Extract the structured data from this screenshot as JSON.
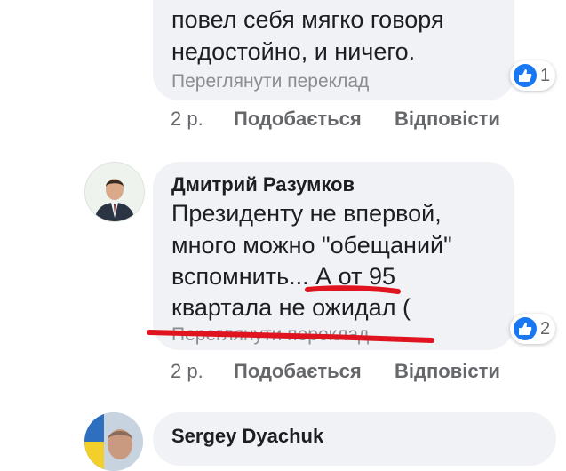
{
  "comment1": {
    "lines": [
      "повел себя мягко говоря",
      "недостойно, и ничего."
    ],
    "translate": "Переглянути переклад",
    "reactions": "1",
    "time": "2 р.",
    "like": "Подобається",
    "reply": "Відповісти"
  },
  "comment2": {
    "author": "Дмитрий Разумков",
    "lines": [
      "Президенту не впервой,",
      "много можно \"обещаний\"",
      "вспомнить... А от 95",
      "квартала не ожидал ("
    ],
    "translate": "Переглянути переклад",
    "reactions": "2",
    "time": "2 р.",
    "like": "Подобається",
    "reply": "Відповісти"
  },
  "comment3": {
    "author": "Sergey  Dyachuk"
  },
  "colors": {
    "bubble": "#f0f2f5",
    "like_blue": "#1877f2",
    "annotation_red": "#e0141e"
  },
  "icons": [
    "like-icon",
    "avatar"
  ]
}
